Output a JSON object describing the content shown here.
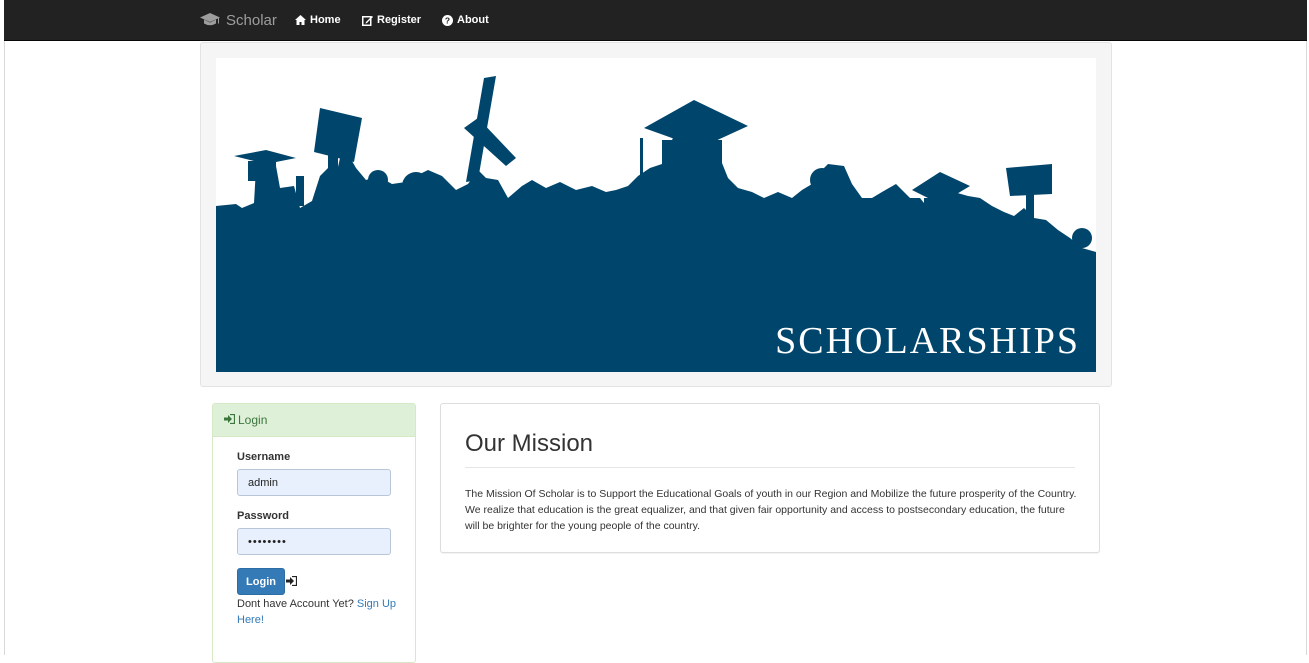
{
  "navbar": {
    "brand": "Scholar",
    "brand_icon": "graduation-cap-icon",
    "links": [
      {
        "label": "Home",
        "icon": "home-icon"
      },
      {
        "label": "Register",
        "icon": "edit-icon"
      },
      {
        "label": "About",
        "icon": "question-circle-icon"
      }
    ]
  },
  "banner": {
    "title": "SCHOLARSHIPS",
    "colors": {
      "silhouette": "#00456b",
      "background": "#ffffff"
    }
  },
  "login": {
    "heading": "Login",
    "username_label": "Username",
    "username_value": "admin",
    "password_label": "Password",
    "password_value": "••••••••",
    "button_label": "Login",
    "no_account_text": "Dont have Account Yet? ",
    "signup_link": "Sign Up Here!"
  },
  "mission": {
    "title": "Our Mission",
    "body": "The Mission Of Scholar is to Support the Educational Goals of youth in our Region and Mobilize the future prosperity of the Country. We realize that education is the great equalizer, and that given fair opportunity and access to postsecondary education, the future will be brighter for the young people of the country."
  },
  "colors": {
    "navbar": "#222222",
    "primary": "#337ab7",
    "success_bg": "#dff0d8",
    "success_text": "#3c763d"
  }
}
